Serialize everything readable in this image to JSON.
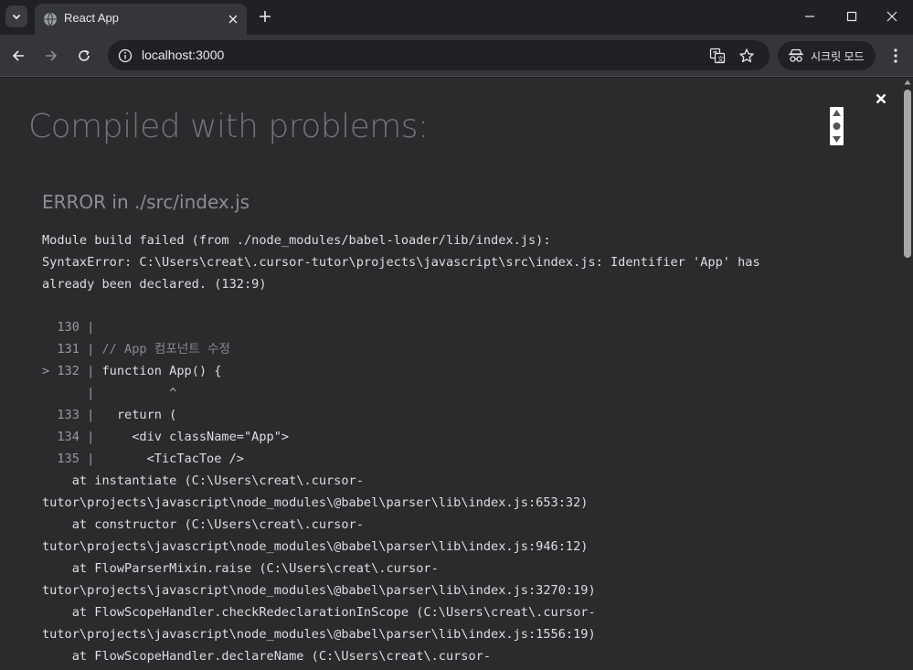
{
  "browser": {
    "tab": {
      "title": "React App"
    },
    "address_bar": {
      "url": "localhost:3000"
    },
    "incognito_label": "시크릿 모드",
    "icons": [
      "tab-search-icon",
      "globe-favicon-icon",
      "close-icon",
      "plus-icon",
      "minimize-icon",
      "maximize-icon",
      "window-close-icon",
      "back-arrow-icon",
      "forward-arrow-icon",
      "reload-icon",
      "site-info-icon",
      "translate-icon",
      "bookmark-star-icon",
      "incognito-icon",
      "more-vert-icon"
    ]
  },
  "overlay": {
    "title": "Compiled with problems:",
    "error_heading": "ERROR in ./src/index.js",
    "message_lines": [
      "Module build failed (from ./node_modules/babel-loader/lib/index.js):",
      "SyntaxError: C:\\Users\\creat\\.cursor-tutor\\projects\\javascript\\src\\index.js: Identifier 'App' has",
      "already been declared. (132:9)"
    ],
    "code_frame": [
      {
        "prefix": "  130 | ",
        "text": "",
        "kind": "code"
      },
      {
        "prefix": "  131 | ",
        "text": "// App 컴포넌트 수정",
        "kind": "comment"
      },
      {
        "prefix": "> 132 | ",
        "text": "function App() {",
        "kind": "code"
      },
      {
        "prefix": "      | ",
        "text": "         ^",
        "kind": "marker"
      },
      {
        "prefix": "  133 | ",
        "text": "  return (",
        "kind": "code"
      },
      {
        "prefix": "  134 | ",
        "text": "    <div className=\"App\">",
        "kind": "code"
      },
      {
        "prefix": "  135 | ",
        "text": "      <TicTacToe />",
        "kind": "code"
      }
    ],
    "stack_lines": [
      "    at instantiate (C:\\Users\\creat\\.cursor-",
      "tutor\\projects\\javascript\\node_modules\\@babel\\parser\\lib\\index.js:653:32)",
      "    at constructor (C:\\Users\\creat\\.cursor-",
      "tutor\\projects\\javascript\\node_modules\\@babel\\parser\\lib\\index.js:946:12)",
      "    at FlowParserMixin.raise (C:\\Users\\creat\\.cursor-",
      "tutor\\projects\\javascript\\node_modules\\@babel\\parser\\lib\\index.js:3270:19)",
      "    at FlowScopeHandler.checkRedeclarationInScope (C:\\Users\\creat\\.cursor-",
      "tutor\\projects\\javascript\\node_modules\\@babel\\parser\\lib\\index.js:1556:19)",
      "    at FlowScopeHandler.declareName (C:\\Users\\creat\\.cursor-"
    ]
  },
  "colors": {
    "chrome_bg": "#202124",
    "toolbar_bg": "#35363a",
    "overlay_bg": "#2b2a2c",
    "title_text": "#74737a",
    "body_text": "#dedde2"
  }
}
